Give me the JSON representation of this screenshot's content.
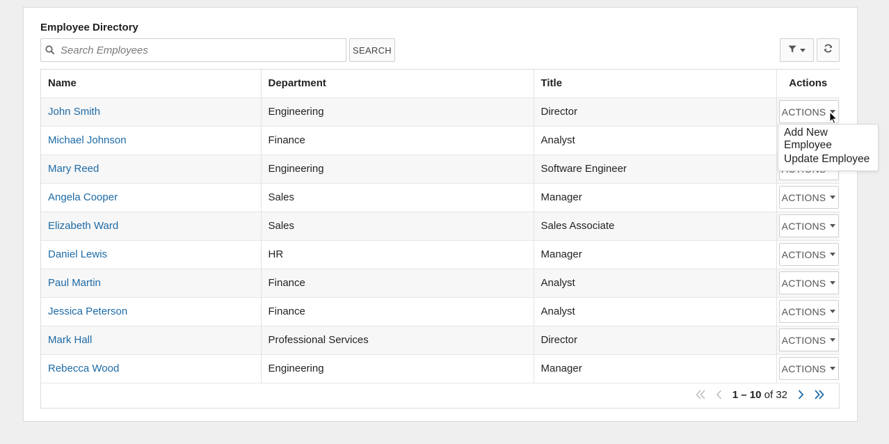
{
  "panel": {
    "title": "Employee Directory",
    "search_placeholder": "Search Employees",
    "search_button": "SEARCH"
  },
  "table": {
    "headers": [
      "Name",
      "Department",
      "Title",
      "Actions"
    ],
    "action_label": "ACTIONS",
    "rows": [
      {
        "name": "John Smith",
        "department": "Engineering",
        "title": "Director"
      },
      {
        "name": "Michael Johnson",
        "department": "Finance",
        "title": "Analyst"
      },
      {
        "name": "Mary Reed",
        "department": "Engineering",
        "title": "Software Engineer"
      },
      {
        "name": "Angela Cooper",
        "department": "Sales",
        "title": "Manager"
      },
      {
        "name": "Elizabeth Ward",
        "department": "Sales",
        "title": "Sales Associate"
      },
      {
        "name": "Daniel Lewis",
        "department": "HR",
        "title": "Manager"
      },
      {
        "name": "Paul Martin",
        "department": "Finance",
        "title": "Analyst"
      },
      {
        "name": "Jessica Peterson",
        "department": "Finance",
        "title": "Analyst"
      },
      {
        "name": "Mark Hall",
        "department": "Professional Services",
        "title": "Director"
      },
      {
        "name": "Rebecca Wood",
        "department": "Engineering",
        "title": "Manager"
      }
    ]
  },
  "menu": {
    "items": [
      "Add New Employee",
      "Update Employee"
    ]
  },
  "pager": {
    "range": "1 – 10",
    "of_label": "of",
    "total": "32"
  },
  "icons": {
    "search": "magnifier-icon",
    "filter": "filter-icon",
    "refresh": "refresh-icon",
    "first": "double-chevron-left-icon",
    "prev": "chevron-left-icon",
    "next": "chevron-right-icon",
    "last": "double-chevron-right-icon"
  },
  "colors": {
    "link": "#1d6aa6",
    "pager_disabled": "#bdbdbd",
    "pager_active": "#1d6aa6"
  }
}
